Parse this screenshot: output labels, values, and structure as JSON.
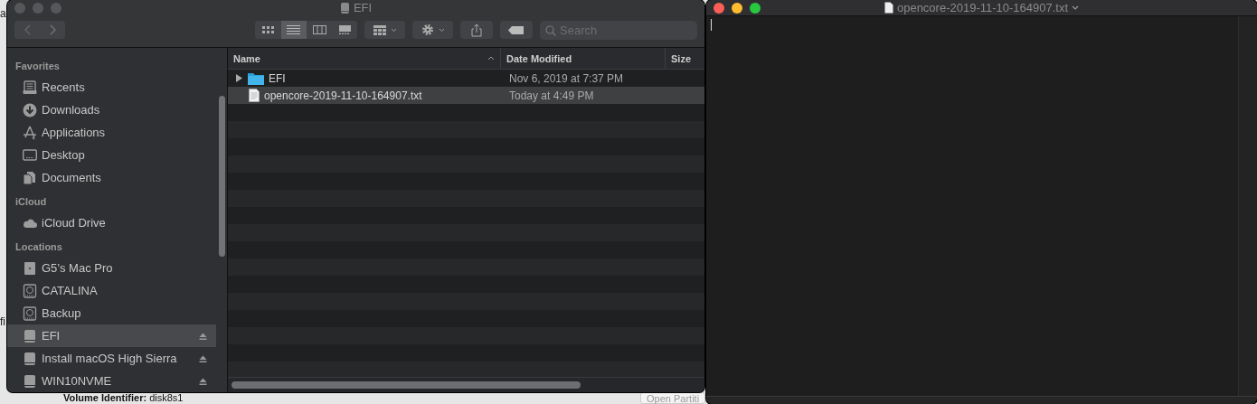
{
  "background_app": {
    "fragments": [
      "a",
      "fi"
    ],
    "volume_identifier_label": "Volume Identifier:",
    "volume_identifier": "disk8s1",
    "button": "Open Partiti"
  },
  "finder": {
    "title": "EFI",
    "search": {
      "placeholder": "Search"
    },
    "view_modes": [
      {
        "kind": "icons",
        "selected": false
      },
      {
        "kind": "list",
        "selected": true
      },
      {
        "kind": "columns",
        "selected": false
      },
      {
        "kind": "gallery",
        "selected": false
      }
    ],
    "sidebar": [
      {
        "heading": "Favorites",
        "items": [
          {
            "label": "Recents",
            "kind": "recents",
            "selected": false,
            "ejectable": false
          },
          {
            "label": "Downloads",
            "kind": "downloads",
            "selected": false,
            "ejectable": false
          },
          {
            "label": "Applications",
            "kind": "applications",
            "selected": false,
            "ejectable": false
          },
          {
            "label": "Desktop",
            "kind": "desktop",
            "selected": false,
            "ejectable": false
          },
          {
            "label": "Documents",
            "kind": "documents",
            "selected": false,
            "ejectable": false
          }
        ]
      },
      {
        "heading": "iCloud",
        "items": [
          {
            "label": "iCloud Drive",
            "kind": "cloud",
            "selected": false,
            "ejectable": false
          }
        ]
      },
      {
        "heading": "Locations",
        "items": [
          {
            "label": "G5’s Mac Pro",
            "kind": "computer",
            "selected": false,
            "ejectable": false
          },
          {
            "label": "CATALINA",
            "kind": "harddisk",
            "selected": false,
            "ejectable": false
          },
          {
            "label": "Backup",
            "kind": "harddisk",
            "selected": false,
            "ejectable": false
          },
          {
            "label": "EFI",
            "kind": "drive",
            "selected": true,
            "ejectable": true
          },
          {
            "label": "Install macOS High Sierra",
            "kind": "drive",
            "selected": false,
            "ejectable": true
          },
          {
            "label": "WIN10NVME",
            "kind": "drive",
            "selected": false,
            "ejectable": true
          }
        ]
      }
    ],
    "columns": [
      {
        "label": "Name",
        "sorted": true
      },
      {
        "label": "Date Modified",
        "sorted": false
      },
      {
        "label": "Size",
        "sorted": false
      }
    ],
    "rows": [
      {
        "name": "EFI",
        "kind": "folder",
        "expanded": false,
        "date_modified": "Nov 6, 2019 at 7:37 PM",
        "selected": false
      },
      {
        "name": "opencore-2019-11-10-164907.txt",
        "kind": "text",
        "date_modified": "Today at 4:49 PM",
        "selected": true
      }
    ]
  },
  "editor": {
    "title": "opencore-2019-11-10-164907.txt"
  }
}
